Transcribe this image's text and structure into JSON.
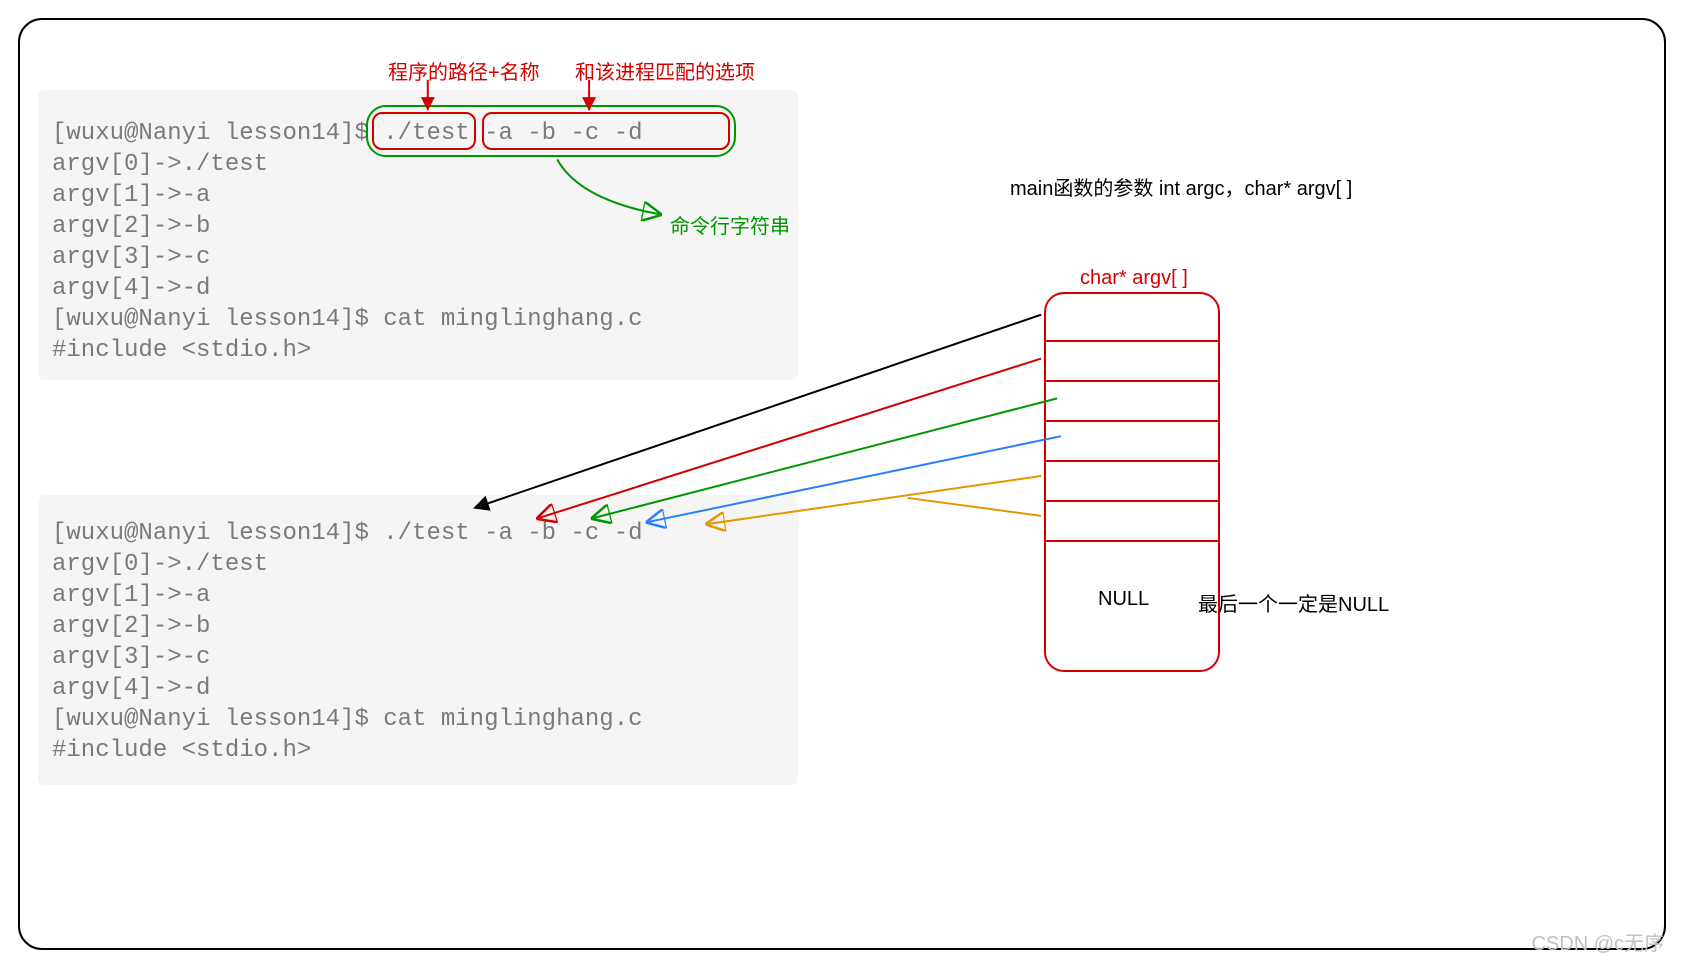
{
  "topAnnots": {
    "pathName": "程序的路径+名称",
    "options": "和该进程匹配的选项"
  },
  "greenAnnot": "命令行字符串",
  "mainParams": "main函数的参数 int argc，char* argv[ ]",
  "argvTitle": "char* argv[ ]",
  "nullLabel": "NULL",
  "nullNote": "最后一个一定是NULL",
  "watermark": "CSDN @c无序",
  "term1": {
    "l1": "[wuxu@Nanyi lesson14]$ ./test -a -b -c -d",
    "l2": "argv[0]->./test",
    "l3": "argv[1]->-a",
    "l4": "argv[2]->-b",
    "l5": "argv[3]->-c",
    "l6": "argv[4]->-d",
    "l7": "[wuxu@Nanyi lesson14]$ cat minglinghang.c",
    "l8": "#include <stdio.h>"
  },
  "term2": {
    "l1": "[wuxu@Nanyi lesson14]$ ./test -a -b -c -d",
    "l2": "argv[0]->./test",
    "l3": "argv[1]->-a",
    "l4": "argv[2]->-b",
    "l5": "argv[3]->-c",
    "l6": "argv[4]->-d",
    "l7": "[wuxu@Nanyi lesson14]$ cat minglinghang.c",
    "l8": "#include <stdio.h>"
  }
}
